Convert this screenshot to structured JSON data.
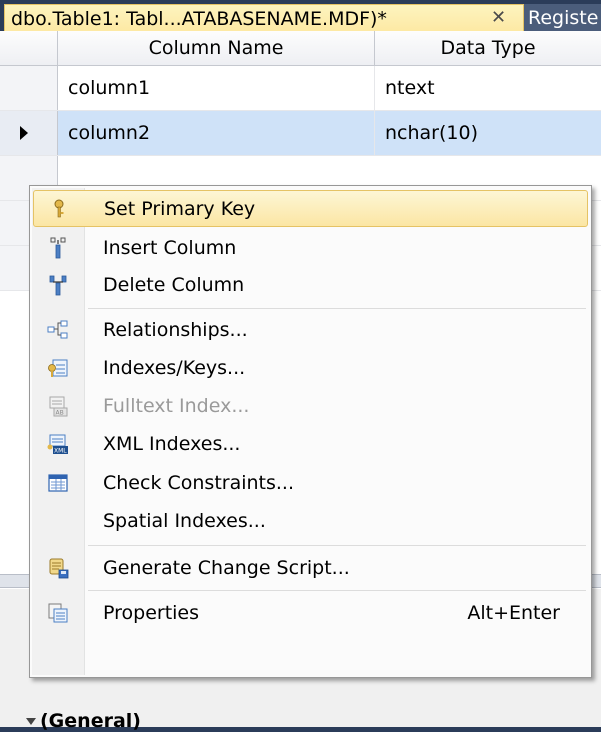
{
  "tabs": {
    "active_title": "dbo.Table1: Tabl...ATABASENAME.MDF)*",
    "close_glyph": "✕",
    "other_title": "Registe"
  },
  "grid": {
    "headers": [
      "Column Name",
      "Data Type"
    ],
    "rows": [
      {
        "name": "column1",
        "type": "ntext"
      },
      {
        "name": "column2",
        "type": "nchar(10)"
      }
    ]
  },
  "properties": {
    "section_label": "(General)"
  },
  "context_menu": {
    "items": [
      {
        "label": "Set Primary Key",
        "icon": "key-icon",
        "state": "hover"
      },
      {
        "label": "Insert Column",
        "icon": "insert-column-icon"
      },
      {
        "label": "Delete Column",
        "icon": "delete-column-icon"
      },
      {
        "label": "Relationships...",
        "icon": "relationships-icon"
      },
      {
        "label": "Indexes/Keys...",
        "icon": "indexes-keys-icon"
      },
      {
        "label": "Fulltext Index...",
        "icon": "fulltext-index-icon",
        "state": "disabled"
      },
      {
        "label": "XML Indexes...",
        "icon": "xml-indexes-icon"
      },
      {
        "label": "Check Constraints...",
        "icon": "check-constraints-icon"
      },
      {
        "label": "Spatial Indexes..."
      },
      {
        "label": "Generate Change Script...",
        "icon": "generate-script-icon"
      },
      {
        "label": "Properties",
        "icon": "properties-icon",
        "shortcut": "Alt+Enter"
      }
    ]
  },
  "colors": {
    "hover_background": "#fbe6a4",
    "selected_row": "#cfe2f8",
    "tab_strip": "#2b3c59"
  }
}
